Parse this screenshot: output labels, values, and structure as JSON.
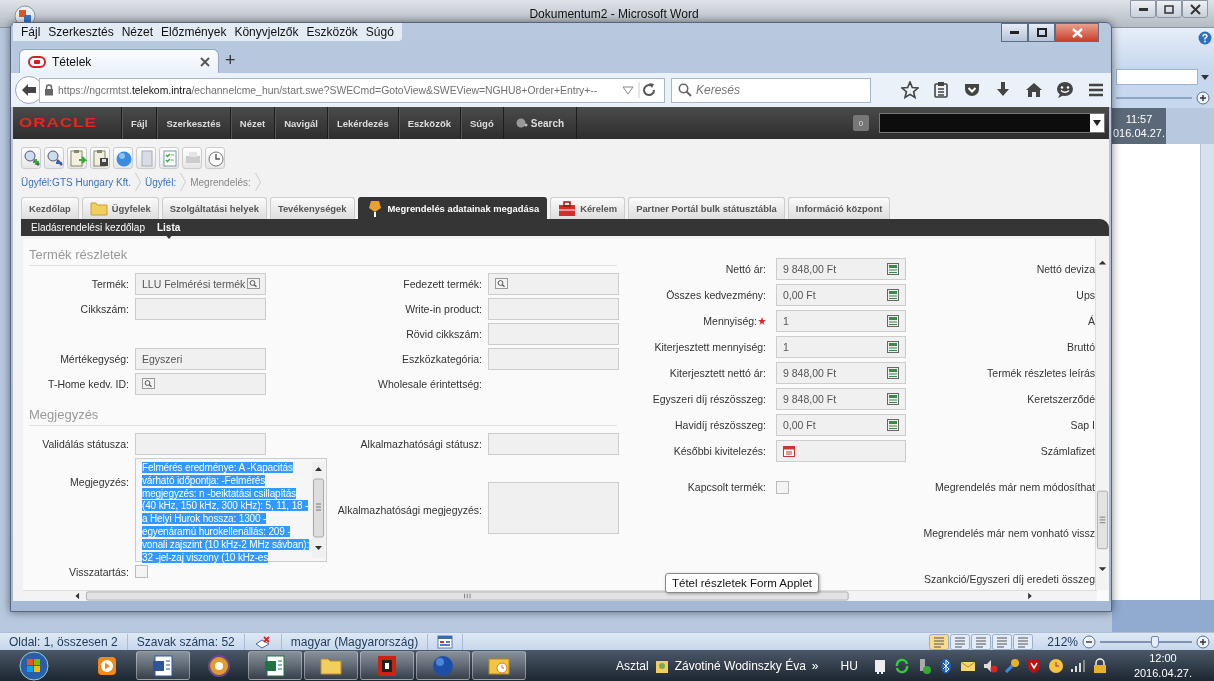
{
  "word": {
    "title": "Dokumentum2 - Microsoft Word",
    "clock_panel": {
      "time": "11:57",
      "date": "016.04.27."
    },
    "status_bar": {
      "page": "Oldal: 1, összesen 2",
      "words": "Szavak száma: 52",
      "language": "magyar (Magyarország)",
      "zoom": "212%",
      "zoom_slider": {
        "level": 0.6
      }
    }
  },
  "browser": {
    "menu": [
      "Fájl",
      "Szerkesztés",
      "Nézet",
      "Előzmények",
      "Könyvjelzők",
      "Eszközök",
      "Súgó"
    ],
    "tabs": [
      {
        "label": "Tételek",
        "selected": true
      }
    ],
    "new_tab": "+",
    "url": "https://ngcrmtst.**telekom.intra**/echannelcme_hun/start.swe?SWECmd=GotoView&SWEView=NGHU8+Order+Entry+--",
    "search": {
      "placeholder": "Keresés"
    }
  },
  "app": {
    "logo": "ORACLE",
    "menu": [
      "Fájl",
      "Szerkesztés",
      "Nézet",
      "Navigál",
      "Lekérdezés",
      "Eszközök",
      "Súgó"
    ],
    "search": "Search",
    "badge": "0",
    "breadcrumbs": [
      {
        "label": "Ügyfél:GTS Hungary Kft.",
        "link": true
      },
      {
        "label": "Ügyfél:",
        "link": true
      },
      {
        "label": "Megrendelés:",
        "link": false
      }
    ],
    "tabs": [
      {
        "label": "Kezdőlap",
        "kind": "plain",
        "selected": false
      },
      {
        "label": "Ügyfelek",
        "kind": "folder",
        "selected": false
      },
      {
        "label": "Szolgáltatási helyek",
        "kind": "plain",
        "selected": false
      },
      {
        "label": "Tevékenységek",
        "kind": "plain",
        "selected": false
      },
      {
        "label": "Megrendelés adatainak megadása",
        "kind": "order",
        "selected": true
      },
      {
        "label": "Kérelem",
        "kind": "toolbox",
        "selected": false
      },
      {
        "label": "Partner Portál bulk státusztábla",
        "kind": "plain",
        "selected": false
      },
      {
        "label": "Információ központ",
        "kind": "plain",
        "selected": false
      }
    ],
    "subtabs": [
      {
        "label": "Eladásrendelési kezdőlap",
        "selected": false
      },
      {
        "label": "Lista",
        "selected": true
      }
    ],
    "form": {
      "sections": [
        {
          "title": "Termék részletek",
          "rows": [
            {
              "left": {
                "label": "Termék:",
                "kind": "lookup",
                "value": "LLU Felmérési termék"
              },
              "right": {
                "label": "Fedezett termék:",
                "kind": "lookup"
              }
            },
            {
              "left": {
                "label": "Cikkszám:",
                "kind": "text"
              },
              "right": {
                "label": "Write-in product:",
                "kind": "text"
              }
            },
            {
              "left": {
                "kind": "empty"
              },
              "right": {
                "label": "Rövid cikkszám:",
                "kind": "text"
              }
            },
            {
              "left": {
                "label": "Mértékegység:",
                "kind": "text",
                "value": "Egyszeri"
              },
              "right": {
                "label": "Eszközkategória:",
                "kind": "text"
              }
            },
            {
              "left": {
                "label": "T-Home kedv.  ID:",
                "kind": "lookup"
              },
              "right": {
                "label": "Wholesale érintettség:",
                "kind": "none"
              }
            }
          ]
        },
        {
          "title": "Megjegyzés",
          "rows": [
            {
              "left": {
                "label": "Validálás státusza:",
                "kind": "text"
              },
              "right": {
                "label": "Alkalmazhatósági státusz:",
                "kind": "text"
              }
            },
            {
              "left": {
                "label": "Megjegyzés:",
                "kind": "textarea",
                "highlighted": true,
                "value": "Felmérés eredménye: A -Kapacitás várható időpontja:  -Felmérés megjegyzés: n -beiktatási csillapítás (40 kHz, 150 kHz, 300 kHz): 5, 11, 18 -a Helyi Hurok hossza: 1300 -egyenáramú hurokellenállás: 209 -vonali zajszint (10 kHz-2 MHz sávban): 32 -jel-zaj viszony (10 kHz-es"
              },
              "right": {
                "label": "Alkalmazhatósági megjegyzés:",
                "kind": "textarea",
                "highlighted": false
              }
            },
            {
              "left": {
                "label": "Visszatartás:",
                "kind": "checkbox",
                "checked": false
              },
              "right": {
                "kind": "empty"
              }
            }
          ]
        }
      ],
      "details": [
        {
          "label": "Nettó ár:",
          "kind": "calc",
          "value": "9 848,00 Ft",
          "side_label": "Nettó deviza"
        },
        {
          "label": "Összes kedvezmény:",
          "kind": "calc",
          "value": "0,00 Ft",
          "side_label": "Ups"
        },
        {
          "label": "Mennyiség:",
          "kind": "calc",
          "value": "1",
          "required": true,
          "side_label": "Á"
        },
        {
          "label": "Kiterjesztett mennyiség:",
          "kind": "calc",
          "value": "1",
          "side_label": "Bruttó"
        },
        {
          "label": "Kiterjesztett nettó ár:",
          "kind": "calc",
          "value": "9 848,00 Ft",
          "side_label": "Termék részletes leírás"
        },
        {
          "label": "Egyszeri díj részösszeg:",
          "kind": "calc",
          "value": "9 848,00 Ft",
          "side_label": "Keretszerződé"
        },
        {
          "label": "Havidíj részösszeg:",
          "kind": "calc",
          "value": "0,00 Ft",
          "side_label": "Sap I"
        },
        {
          "label": "Későbbi kivitelezés:",
          "kind": "date",
          "side_label": "Számlafizet"
        },
        {
          "label": "Kapcsolt termék:",
          "kind": "checkbox",
          "checked": false,
          "side_label": "Megrendelés már nem módosíthat"
        },
        {
          "kind": "side-only",
          "side_label": "Megrendelés már nem vonható vissz"
        },
        {
          "kind": "side-only",
          "side_label": "Szankció/Egyszeri díj eredeti összeg"
        }
      ],
      "tooltip": "Tétel részletek Form Applet"
    }
  },
  "taskbar": {
    "apps": [
      {
        "kind": "media",
        "open": false
      },
      {
        "kind": "word",
        "open": true
      },
      {
        "kind": "sync",
        "open": false
      },
      {
        "kind": "excel",
        "open": true
      },
      {
        "kind": "folder",
        "open": true
      },
      {
        "kind": "red-app",
        "open": true
      },
      {
        "kind": "globe",
        "open": true
      },
      {
        "kind": "mail",
        "open": true
      }
    ],
    "desktop": "Asztal",
    "user": "Závotiné Wodinszky Éva",
    "more": "»",
    "language": "HU",
    "time": "12:00",
    "date": "2016.04.27."
  }
}
